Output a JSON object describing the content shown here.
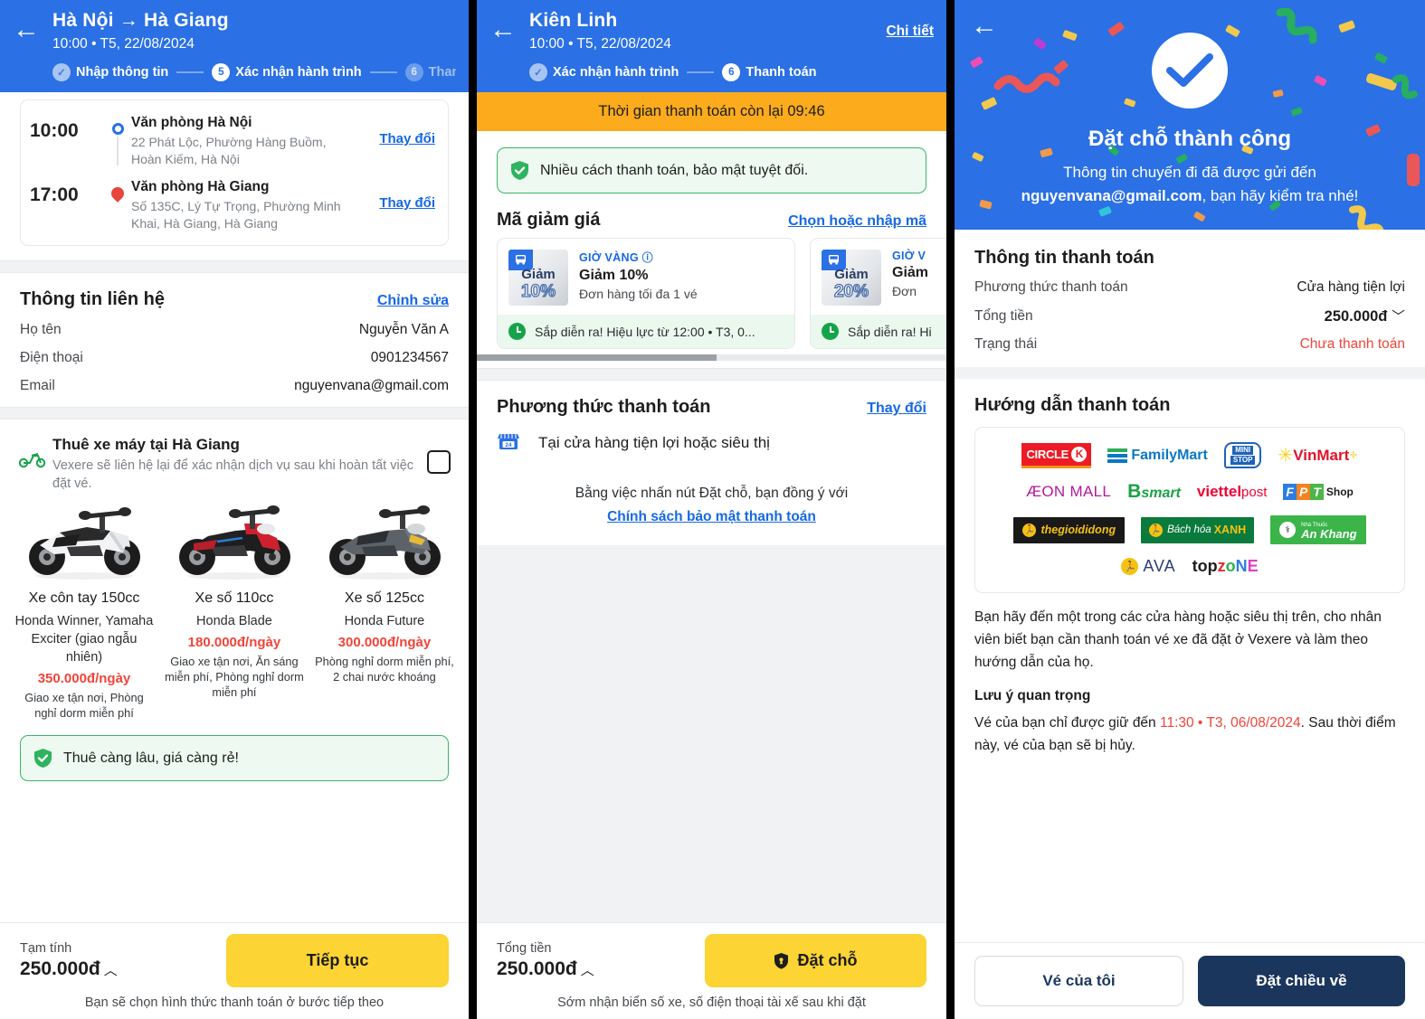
{
  "panel1": {
    "header": {
      "back_icon": "arrow-left-icon",
      "title": "Hà Nội → Hà Giang",
      "subtitle": "10:00 • T5, 22/08/2024",
      "steps": [
        {
          "badge": "✓",
          "label": "Nhập thông tin",
          "state": "done"
        },
        {
          "badge": "5",
          "label": "Xác nhận hành trình",
          "state": "current"
        },
        {
          "badge": "6",
          "label": "Thanh",
          "state": "next"
        }
      ]
    },
    "trip": {
      "legs": [
        {
          "time": "10:00",
          "name": "Văn phòng Hà Nội",
          "address": "22 Phát Lộc, Phường Hàng Buồm, Hoàn Kiếm, Hà Nội",
          "change_label": "Thay đổi",
          "marker": "origin-dot-icon"
        },
        {
          "time": "17:00",
          "name": "Văn phòng Hà Giang",
          "address": "Số 135C, Lý Tự Trọng, Phường Minh Khai, Hà Giang, Hà Giang",
          "change_label": "Thay đổi",
          "marker": "destination-pin-icon"
        }
      ]
    },
    "contact": {
      "title": "Thông tin liên hệ",
      "edit_label": "Chỉnh sửa",
      "rows": [
        {
          "label": "Họ tên",
          "value": "Nguyễn Văn A"
        },
        {
          "label": "Điện thoại",
          "value": "0901234567"
        },
        {
          "label": "Email",
          "value": "nguyenvana@gmail.com"
        }
      ]
    },
    "rental": {
      "icon": "motorbike-icon",
      "title": "Thuê xe máy tại Hà Giang",
      "description": "Vexere sẽ liên hệ lại để xác nhận dịch vụ sau khi hoàn tất việc đặt vé.",
      "checkbox_checked": false,
      "bikes": [
        {
          "name": "Xe côn tay 150cc",
          "model": "Honda Winner, Yamaha Exciter (giao ngẫu nhiên)",
          "price": "350.000đ/ngày",
          "perks": "Giao xe tận nơi, Phòng nghỉ dorm miễn phí",
          "image": "motorbike-white-manual"
        },
        {
          "name": "Xe số 110cc",
          "model": "Honda Blade",
          "price": "180.000đ/ngày",
          "perks": "Giao xe tận nơi, Ăn sáng miễn phí, Phòng nghỉ dorm miễn phí",
          "image": "motorbike-red-blade"
        },
        {
          "name": "Xe số 125cc",
          "model": "Honda Future",
          "price": "300.000đ/ngày",
          "perks": "Phòng nghỉ dorm miễn phí, 2 chai nước khoáng",
          "image": "motorbike-grey-future"
        }
      ],
      "promo_banner": "Thuê càng lâu, giá càng rẻ!"
    },
    "bottom": {
      "total_label": "Tạm tính",
      "total_value": "250.000đ",
      "caret": "chevron-up-icon",
      "cta": "Tiếp tục",
      "hint": "Bạn sẽ chọn hình thức thanh toán ở bước tiếp theo"
    }
  },
  "panel2": {
    "header": {
      "back_icon": "arrow-left-icon",
      "title": "Kiên Linh",
      "subtitle": "10:00 • T5, 22/08/2024",
      "detail_link": "Chi tiết",
      "steps": [
        {
          "badge": "✓",
          "label": "Xác nhận hành trình",
          "state": "done"
        },
        {
          "badge": "6",
          "label": "Thanh toán",
          "state": "current"
        }
      ]
    },
    "timer": "Thời gian thanh toán còn lại 09:46",
    "secure_banner": "Nhiều cách thanh toán, bảo mật tuyệt đối.",
    "discount": {
      "title": "Mã giảm giá",
      "link": "Chọn hoặc nhập mã",
      "coupons": [
        {
          "thumb_word": "Giảm",
          "thumb_percent": "10%",
          "tag": "GIỜ VÀNG",
          "info_icon": "info-icon",
          "title": "Giảm 10%",
          "subtitle": "Đơn hàng tối đa 1 vé",
          "footer": "Sắp diễn ra! Hiệu lực từ 12:00 • T3, 0..."
        },
        {
          "thumb_word": "Giảm",
          "thumb_percent": "20%",
          "tag": "GIỜ V",
          "info_icon": "info-icon",
          "title": "Giảm",
          "subtitle": "Đơn",
          "footer": "Sắp diễn ra! Hi"
        }
      ]
    },
    "payment": {
      "title": "Phương thức thanh toán",
      "change_link": "Thay đổi",
      "method_icon": "convenience-store-icon",
      "method_label": "Tại cửa hàng tiện lợi hoặc siêu thị",
      "agree_text": "Bằng việc nhấn nút Đặt chỗ, bạn đồng ý với",
      "agree_link": "Chính sách bảo mật thanh toán"
    },
    "bottom": {
      "total_label": "Tổng tiền",
      "total_value": "250.000đ",
      "caret": "chevron-up-icon",
      "cta": "Đặt chỗ",
      "cta_icon": "lock-shield-icon",
      "hint": "Sớm nhận biển số xe, số điện thoại tài xế sau khi đặt"
    }
  },
  "panel3": {
    "success": {
      "back_icon": "arrow-left-icon",
      "check_icon": "check-circle-icon",
      "title": "Đặt chỗ thành công",
      "sub_before": "Thông tin chuyến đi đã được gửi đến",
      "email": "nguyenvana@gmail.com",
      "sub_after": ", bạn hãy kiểm tra nhé!"
    },
    "payinfo": {
      "title": "Thông tin thanh toán",
      "rows": [
        {
          "label": "Phương thức thanh toán",
          "value": "Cửa hàng tiện lợi",
          "style": "plain"
        },
        {
          "label": "Tổng tiền",
          "value": "250.000đ",
          "style": "bold",
          "caret": "chevron-down-icon"
        },
        {
          "label": "Trạng thái",
          "value": "Chưa thanh toán",
          "style": "red"
        }
      ]
    },
    "guide": {
      "title": "Hướng dẫn thanh toán",
      "logo_rows": [
        [
          "CIRCLE K",
          "FamilyMart",
          "MINI STOP",
          "VinMart"
        ],
        [
          "ÆON MALL",
          "B's mart",
          "viettel post",
          "FPT Shop"
        ],
        [
          "thegioididong",
          "Bách hóa XANH",
          "An Khang"
        ],
        [
          "AVA",
          "topzone"
        ]
      ],
      "paragraph": "Bạn hãy đến một trong các cửa hàng hoặc siêu thị trên, cho nhân viên biết bạn cần thanh toán vé xe đã đặt ở Vexere và làm theo hướng dẫn của họ.",
      "note_title": "Lưu ý quan trọng",
      "note_before": "Vé của bạn chỉ được giữ đến ",
      "note_deadline": "11:30 • T3, 06/08/2024",
      "note_after": ". Sau thời điểm này, vé của bạn sẽ bị hủy."
    },
    "bottom": {
      "secondary": "Vé của tôi",
      "primary": "Đặt chiều về"
    }
  }
}
